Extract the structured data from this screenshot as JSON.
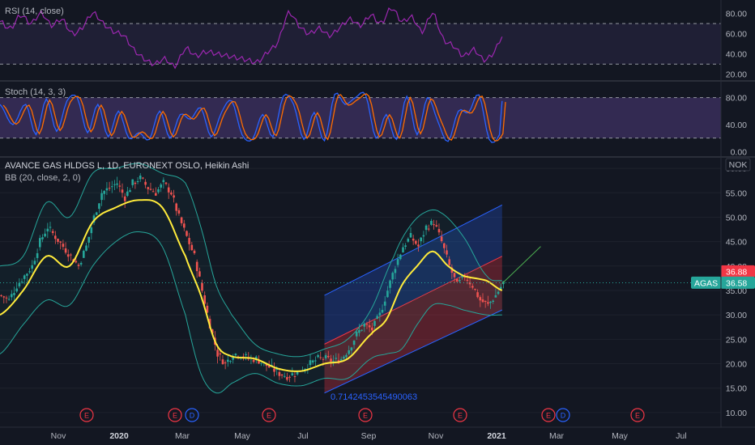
{
  "chart_data": {
    "type": "candlestick",
    "title": "AVANCE GAS HLDGS L, 1D, EURONEXT OSLO, Heikin Ashi",
    "indicator_label": "BB (20, close, 2, 0)",
    "currency": "NOK",
    "symbol": "AGAS",
    "last_price": "36.58",
    "alt_price": "36.88",
    "fib_label": "0.7142453545490063",
    "x_ticks": [
      {
        "label": "Nov",
        "bold": false
      },
      {
        "label": "2020",
        "bold": true
      },
      {
        "label": "Mar",
        "bold": false
      },
      {
        "label": "May",
        "bold": false
      },
      {
        "label": "Jul",
        "bold": false
      },
      {
        "label": "Sep",
        "bold": false
      },
      {
        "label": "Nov",
        "bold": false
      },
      {
        "label": "2021",
        "bold": true
      },
      {
        "label": "Mar",
        "bold": false
      },
      {
        "label": "May",
        "bold": false
      },
      {
        "label": "Jul",
        "bold": false
      }
    ],
    "price_axis": {
      "min": 7,
      "max": 62,
      "ticks": [
        "60.00",
        "55.00",
        "50.00",
        "45.00",
        "40.00",
        "35.00",
        "30.00",
        "25.00",
        "20.00",
        "15.00",
        "10.00"
      ]
    },
    "price_series": [
      [
        0,
        34
      ],
      [
        3,
        33
      ],
      [
        6,
        36
      ],
      [
        9,
        38
      ],
      [
        12,
        40
      ],
      [
        15,
        45
      ],
      [
        18,
        48
      ],
      [
        21,
        46
      ],
      [
        24,
        44
      ],
      [
        27,
        42
      ],
      [
        30,
        40
      ],
      [
        33,
        44
      ],
      [
        36,
        50
      ],
      [
        39,
        55
      ],
      [
        42,
        56
      ],
      [
        45,
        57
      ],
      [
        48,
        54
      ],
      [
        51,
        57
      ],
      [
        54,
        58
      ],
      [
        57,
        56
      ],
      [
        60,
        55
      ],
      [
        63,
        57
      ],
      [
        66,
        55
      ],
      [
        69,
        50
      ],
      [
        72,
        46
      ],
      [
        75,
        42
      ],
      [
        78,
        35
      ],
      [
        81,
        28
      ],
      [
        84,
        22
      ],
      [
        87,
        20
      ],
      [
        90,
        22
      ],
      [
        93,
        22
      ],
      [
        96,
        21
      ],
      [
        99,
        21
      ],
      [
        102,
        20
      ],
      [
        105,
        19
      ],
      [
        108,
        18
      ],
      [
        111,
        17.5
      ],
      [
        114,
        18
      ],
      [
        117,
        19
      ],
      [
        120,
        20
      ],
      [
        123,
        21
      ],
      [
        126,
        21
      ],
      [
        129,
        20.5
      ],
      [
        132,
        21
      ],
      [
        135,
        23
      ],
      [
        138,
        26
      ],
      [
        141,
        28
      ],
      [
        144,
        27
      ],
      [
        147,
        30
      ],
      [
        150,
        35
      ],
      [
        153,
        40
      ],
      [
        156,
        44
      ],
      [
        159,
        46
      ],
      [
        162,
        44
      ],
      [
        165,
        48
      ],
      [
        168,
        49
      ],
      [
        171,
        45
      ],
      [
        174,
        40
      ],
      [
        177,
        36
      ],
      [
        180,
        38
      ],
      [
        183,
        36
      ],
      [
        186,
        33
      ],
      [
        189,
        32
      ],
      [
        192,
        34
      ],
      [
        195,
        36.6
      ]
    ],
    "bb_upper": [
      [
        0,
        40
      ],
      [
        9,
        42
      ],
      [
        18,
        53
      ],
      [
        27,
        50
      ],
      [
        36,
        59
      ],
      [
        45,
        60
      ],
      [
        54,
        61
      ],
      [
        63,
        59
      ],
      [
        72,
        57
      ],
      [
        78,
        48
      ],
      [
        84,
        36
      ],
      [
        90,
        30
      ],
      [
        99,
        24
      ],
      [
        108,
        22
      ],
      [
        117,
        21.5
      ],
      [
        126,
        23
      ],
      [
        135,
        25
      ],
      [
        144,
        31
      ],
      [
        153,
        42
      ],
      [
        159,
        48
      ],
      [
        165,
        51
      ],
      [
        171,
        51
      ],
      [
        180,
        46
      ],
      [
        189,
        38
      ],
      [
        195,
        37
      ]
    ],
    "bb_basis": [
      [
        0,
        30
      ],
      [
        9,
        35
      ],
      [
        18,
        42
      ],
      [
        27,
        40
      ],
      [
        36,
        49
      ],
      [
        45,
        52
      ],
      [
        54,
        53.5
      ],
      [
        63,
        52
      ],
      [
        72,
        42
      ],
      [
        78,
        34
      ],
      [
        84,
        24
      ],
      [
        90,
        21.5
      ],
      [
        99,
        21
      ],
      [
        108,
        19
      ],
      [
        117,
        18.5
      ],
      [
        126,
        20
      ],
      [
        135,
        21
      ],
      [
        144,
        26
      ],
      [
        150,
        29
      ],
      [
        156,
        36
      ],
      [
        162,
        40
      ],
      [
        168,
        43
      ],
      [
        174,
        40
      ],
      [
        180,
        38
      ],
      [
        189,
        37
      ],
      [
        195,
        35
      ]
    ],
    "bb_lower": [
      [
        0,
        22
      ],
      [
        9,
        28
      ],
      [
        18,
        33
      ],
      [
        27,
        32
      ],
      [
        36,
        40
      ],
      [
        45,
        45
      ],
      [
        54,
        47
      ],
      [
        63,
        44
      ],
      [
        72,
        30
      ],
      [
        78,
        18
      ],
      [
        84,
        14
      ],
      [
        90,
        16
      ],
      [
        99,
        18
      ],
      [
        108,
        16
      ],
      [
        117,
        15.5
      ],
      [
        126,
        17
      ],
      [
        135,
        17
      ],
      [
        144,
        21
      ],
      [
        150,
        22
      ],
      [
        156,
        23
      ],
      [
        162,
        28
      ],
      [
        168,
        32
      ],
      [
        174,
        32
      ],
      [
        180,
        31
      ],
      [
        189,
        30
      ],
      [
        195,
        30
      ]
    ],
    "channel": {
      "x0": 126,
      "x1": 195,
      "upper": [
        34,
        52.5
      ],
      "mid": [
        24,
        42
      ],
      "lower": [
        14,
        31
      ]
    },
    "rsi": {
      "label": "RSI (14, close)",
      "min": 15,
      "max": 90,
      "bands": [
        30,
        70
      ],
      "ticks": [
        "80.00",
        "60.00",
        "40.00",
        "20.00"
      ],
      "values": [
        [
          0,
          72
        ],
        [
          4,
          65
        ],
        [
          8,
          78
        ],
        [
          12,
          70
        ],
        [
          16,
          80
        ],
        [
          20,
          68
        ],
        [
          24,
          74
        ],
        [
          28,
          60
        ],
        [
          32,
          66
        ],
        [
          36,
          80
        ],
        [
          40,
          70
        ],
        [
          44,
          62
        ],
        [
          48,
          58
        ],
        [
          52,
          44
        ],
        [
          56,
          35
        ],
        [
          60,
          30
        ],
        [
          64,
          35
        ],
        [
          68,
          28
        ],
        [
          72,
          45
        ],
        [
          76,
          38
        ],
        [
          80,
          42
        ],
        [
          84,
          40
        ],
        [
          88,
          38
        ],
        [
          92,
          36
        ],
        [
          96,
          34
        ],
        [
          100,
          32
        ],
        [
          104,
          42
        ],
        [
          108,
          52
        ],
        [
          112,
          80
        ],
        [
          116,
          68
        ],
        [
          120,
          60
        ],
        [
          124,
          65
        ],
        [
          128,
          58
        ],
        [
          132,
          66
        ],
        [
          136,
          74
        ],
        [
          140,
          68
        ],
        [
          144,
          78
        ],
        [
          148,
          70
        ],
        [
          152,
          85
        ],
        [
          156,
          72
        ],
        [
          160,
          76
        ],
        [
          164,
          62
        ],
        [
          168,
          80
        ],
        [
          172,
          55
        ],
        [
          176,
          48
        ],
        [
          180,
          38
        ],
        [
          184,
          44
        ],
        [
          188,
          34
        ],
        [
          192,
          42
        ],
        [
          195,
          57
        ]
      ]
    },
    "stoch": {
      "label": "Stoch (14, 3, 3)",
      "min": -2,
      "max": 100,
      "bands": [
        20,
        80
      ],
      "ticks": [
        "80.00",
        "40.00",
        "0.00"
      ],
      "k_values": [
        [
          0,
          70
        ],
        [
          5,
          40
        ],
        [
          10,
          70
        ],
        [
          14,
          25
        ],
        [
          18,
          78
        ],
        [
          22,
          30
        ],
        [
          26,
          75
        ],
        [
          30,
          80
        ],
        [
          34,
          28
        ],
        [
          38,
          70
        ],
        [
          42,
          22
        ],
        [
          46,
          60
        ],
        [
          50,
          20
        ],
        [
          54,
          28
        ],
        [
          58,
          18
        ],
        [
          62,
          60
        ],
        [
          66,
          20
        ],
        [
          70,
          55
        ],
        [
          74,
          48
        ],
        [
          78,
          65
        ],
        [
          82,
          22
        ],
        [
          86,
          58
        ],
        [
          90,
          75
        ],
        [
          94,
          25
        ],
        [
          98,
          18
        ],
        [
          102,
          55
        ],
        [
          106,
          22
        ],
        [
          110,
          82
        ],
        [
          114,
          70
        ],
        [
          118,
          18
        ],
        [
          122,
          58
        ],
        [
          126,
          16
        ],
        [
          130,
          85
        ],
        [
          134,
          70
        ],
        [
          138,
          80
        ],
        [
          142,
          84
        ],
        [
          146,
          20
        ],
        [
          150,
          55
        ],
        [
          154,
          18
        ],
        [
          158,
          82
        ],
        [
          162,
          25
        ],
        [
          166,
          80
        ],
        [
          170,
          45
        ],
        [
          174,
          15
        ],
        [
          178,
          60
        ],
        [
          182,
          58
        ],
        [
          186,
          84
        ],
        [
          190,
          18
        ],
        [
          194,
          25
        ],
        [
          195,
          75
        ]
      ]
    }
  }
}
